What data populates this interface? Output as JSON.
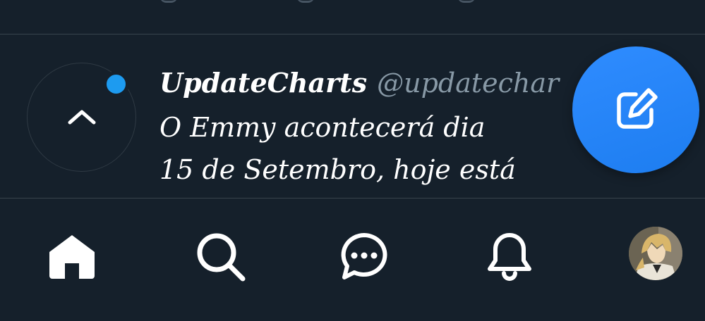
{
  "tweet": {
    "display_name": "UpdateCharts",
    "handle": "@updatechar",
    "body": "O Emmy acontecerá dia\n15 de Setembro, hoje está"
  },
  "icons": {
    "scroll_top": "chevron-up-icon",
    "compose": "compose-icon",
    "home": "home-icon",
    "search": "search-icon",
    "messages": "messages-icon",
    "notifications": "bell-icon"
  },
  "colors": {
    "background": "#15202b",
    "accent": "#1d9bf0",
    "divider": "#38444d",
    "handle": "#8899a6"
  }
}
